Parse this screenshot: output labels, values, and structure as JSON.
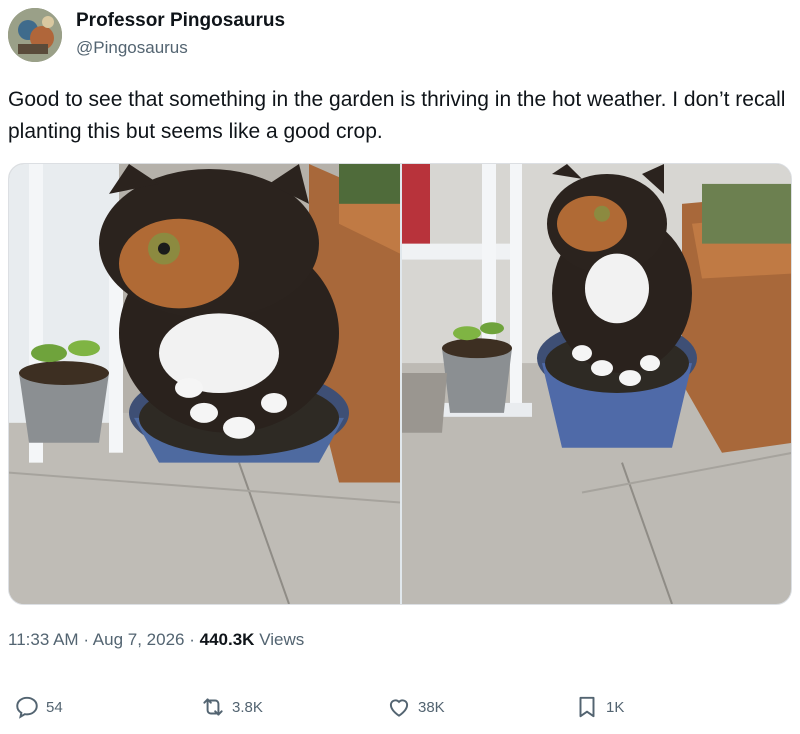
{
  "author": {
    "name": "Professor Pingosaurus",
    "handle": "@Pingosaurus"
  },
  "tweet": {
    "text": "Good to see that something in the garden is thriving in the hot weather. I don’t recall planting this but seems like a good crop."
  },
  "meta": {
    "time": "11:33 AM",
    "separator": "·",
    "date": "Aug 7, 2026",
    "views_count": "440.3K",
    "views_label": "Views"
  },
  "actions": {
    "reply_count": "54",
    "retweet_count": "3.8K",
    "like_count": "38K",
    "bookmark_count": "1K"
  },
  "icons": [
    "avatar",
    "reply-icon",
    "retweet-icon",
    "like-icon",
    "bookmark-icon"
  ],
  "colors": {
    "text_primary": "#0f1419",
    "text_secondary": "#536471"
  }
}
